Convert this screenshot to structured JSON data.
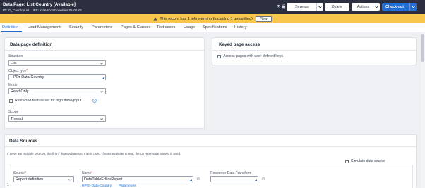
{
  "header": {
    "title": "Data Page: List Country [Available]",
    "id_label": "ID:",
    "id_value": "D_CountryList",
    "rs_label": "RS:",
    "rs_value": "COVID19Countries:01-01-01",
    "buttons": {
      "save_as": "Save as",
      "delete": "Delete",
      "actions": "Actions",
      "check_out": "Check out"
    }
  },
  "warning": {
    "message": "This record has 1 info warning (including 1 unjustified)",
    "view_label": "View"
  },
  "tabs": [
    {
      "label": "Definition",
      "active": true
    },
    {
      "label": "Load Management"
    },
    {
      "label": "Security"
    },
    {
      "label": "Parameters"
    },
    {
      "label": "Pages & Classes"
    },
    {
      "label": "Test cases"
    },
    {
      "label": "Usage"
    },
    {
      "label": "Specifications"
    },
    {
      "label": "History"
    }
  ],
  "definition": {
    "title": "Data page definition",
    "structure_label": "Structure",
    "structure_value": "List",
    "object_type_label": "Object type",
    "object_type_value": "HPOr-Data-Country",
    "mode_label": "Mode",
    "mode_value": "Read Only",
    "restricted_label": "Restricted feature set for high throughput",
    "scope_label": "Scope",
    "scope_value": "Thread"
  },
  "keyed": {
    "title": "Keyed page access",
    "checkbox_label": "Access pages with user defined keys"
  },
  "sources": {
    "title": "Data Sources",
    "info": "If there are multiple sources, the first if that evaluates to true is used. If none evaluate to true, the OTHERWISE source is used.",
    "simulate_label": "Simulate data source",
    "row_number": "1",
    "source_label": "Source",
    "source_value": "Report definition",
    "name_label": "Name",
    "name_value": "DataTableEditorReport",
    "name_link_class": "HPOr-Data-Country",
    "name_link_params": "Parameters",
    "response_label": "Response Data Transform"
  }
}
